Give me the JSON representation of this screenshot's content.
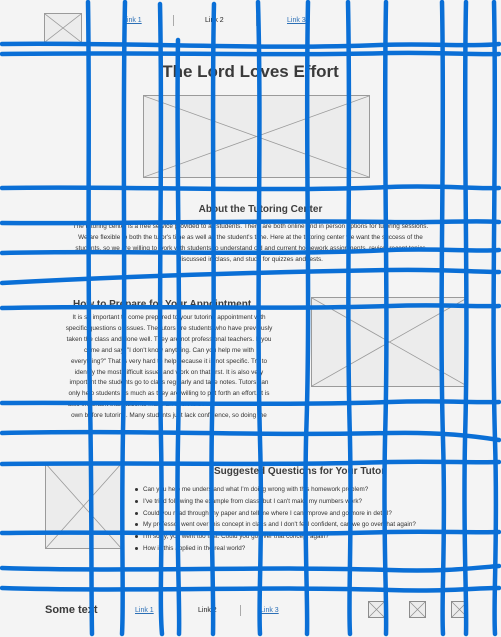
{
  "header": {
    "logo_icon": "image-placeholder-icon",
    "links": [
      "Link 1",
      "Link 2",
      "Link 3"
    ]
  },
  "hero": {
    "title": "The Lord Loves Effort",
    "image_icon": "image-placeholder-icon"
  },
  "about": {
    "heading": "About the Tutoring Center",
    "lines": [
      "The tutoring center is a free service provided to all students. There are both online and in person options for tutoring sessions.",
      "We are flexible to both the tutor's time as well as the student's time. Here at the tutoring center we want the success of the",
      "students, so we are willing to work with students to understand old and current homework assignments, review recent topics",
      "discussed in class, and study for quizzes and tests."
    ]
  },
  "prepare": {
    "heading": "How to Prepare for Your Appointment",
    "lines": [
      "It is so important to come prepared to your tutoring appointment with",
      "specific questions or issues. The tutors are students who have previously",
      "taken the class and done well. They are not professional teachers. If you",
      "come and say, \"I don't know anything. Can you help me with",
      "everything?\" That is very hard to help because it is not specific. Try to",
      "identify the most difficult issue, and work on that first. It is also very",
      "important the students go to class regularly and take notes. Tutors can",
      "only help students as much as they are willing to put forth an effort. It is",
      "also important that students make an effort to do the homework on their",
      "own before tutoring. Many students just lack confidence, so doing the"
    ],
    "image_icon": "image-placeholder-icon"
  },
  "questions": {
    "heading": "Suggested Questions for Your Tutor",
    "items": [
      "Can you help me understand what I'm doing wrong with this homework problem?",
      "I've tried following the example from class, but I can't make my numbers work?",
      "Could you read through my paper and tell me where I can improve and go more in detail?",
      "My professor went over this concept in class and I don't feel confident, can we go over that again?",
      "I'm sorry, you went too fast. Could you go over that concept again?",
      "How is this applied in the real world?"
    ],
    "image_icon": "image-placeholder-icon"
  },
  "footer": {
    "brand": "Some text",
    "links": [
      "Link 1",
      "Link 2",
      "Link 3"
    ],
    "social_icons": [
      "image-placeholder-icon",
      "image-placeholder-icon",
      "image-placeholder-icon"
    ]
  },
  "colors": {
    "background": "#f4f4f4",
    "link": "#2b6fb6",
    "scribble": "#0a6fd6",
    "placeholder": "#ececec"
  }
}
